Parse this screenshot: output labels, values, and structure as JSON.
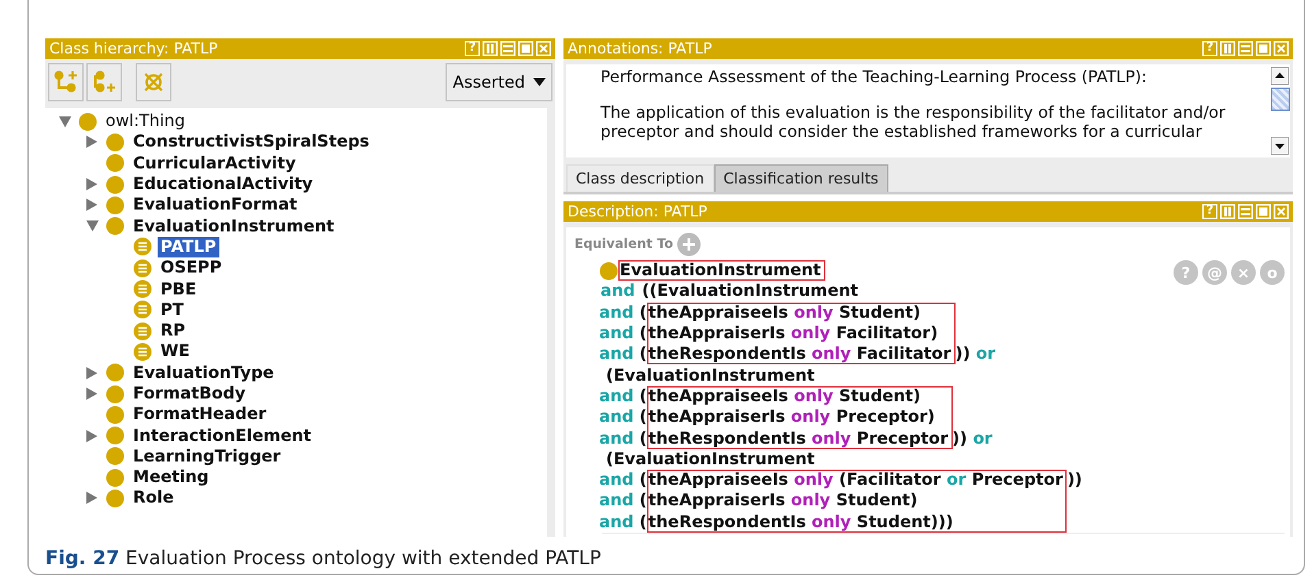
{
  "class_hierarchy": {
    "title": "Class hierarchy: PATLP",
    "help": "?",
    "view_mode": "Asserted",
    "tree": [
      {
        "label": "owl:Thing",
        "kind": "class",
        "expanded": true,
        "selected": false,
        "children": [
          {
            "label": "ConstructivistSpiralSteps",
            "kind": "class",
            "expanded": false,
            "selected": false
          },
          {
            "label": "CurricularActivity",
            "kind": "class",
            "selected": false
          },
          {
            "label": "EducationalActivity",
            "kind": "class",
            "expanded": false,
            "selected": false
          },
          {
            "label": "EvaluationFormat",
            "kind": "class",
            "expanded": false,
            "selected": false
          },
          {
            "label": "EvaluationInstrument",
            "kind": "class",
            "expanded": true,
            "selected": false,
            "children": [
              {
                "label": "PATLP",
                "kind": "defined",
                "selected": true
              },
              {
                "label": "OSEPP",
                "kind": "defined",
                "selected": false
              },
              {
                "label": "PBE",
                "kind": "defined",
                "selected": false
              },
              {
                "label": "PT",
                "kind": "defined",
                "selected": false
              },
              {
                "label": "RP",
                "kind": "defined",
                "selected": false
              },
              {
                "label": "WE",
                "kind": "defined",
                "selected": false
              }
            ]
          },
          {
            "label": "EvaluationType",
            "kind": "class",
            "expanded": false,
            "selected": false
          },
          {
            "label": "FormatBody",
            "kind": "class",
            "expanded": false,
            "selected": false
          },
          {
            "label": "FormatHeader",
            "kind": "class",
            "selected": false
          },
          {
            "label": "InteractionElement",
            "kind": "class",
            "expanded": false,
            "selected": false
          },
          {
            "label": "LearningTrigger",
            "kind": "class",
            "selected": false
          },
          {
            "label": "Meeting",
            "kind": "class",
            "selected": false
          },
          {
            "label": "Role",
            "kind": "class",
            "expanded": false,
            "selected": false
          }
        ]
      }
    ]
  },
  "annotations": {
    "title": "Annotations: PATLP",
    "help": "?",
    "paragraphs": [
      [
        "Performance Assessment of the Teaching-Learning Process (PATLP):"
      ],
      [
        "The application of this evaluation is the responsibility of the facilitator and/or",
        "preceptor and should consider the established frameworks for a curricular"
      ]
    ]
  },
  "tabs": [
    {
      "label": "Class description",
      "selected": true
    },
    {
      "label": "Classification results",
      "selected": false
    }
  ],
  "description": {
    "title": "Description: PATLP",
    "help": "?",
    "section": "Equivalent To",
    "frame_buttons": [
      "?",
      "@",
      "×",
      "o"
    ],
    "blocks": [
      {
        "highlighted": true,
        "lines": [
          {
            "kind": "class_head",
            "body": [
              {
                "text": "EvaluationInstrument",
                "kind": "plain"
              }
            ]
          }
        ]
      },
      {
        "highlighted": false,
        "lines": [
          {
            "lead": [
              {
                "text": "and",
                "kind": "keyword"
              }
            ],
            "body": [
              {
                "text": "((EvaluationInstrument",
                "kind": "plain"
              }
            ]
          }
        ]
      },
      {
        "highlighted": true,
        "lines": [
          {
            "lead": [
              {
                "text": "and",
                "kind": "keyword"
              },
              {
                "text": " (",
                "kind": "plain"
              }
            ],
            "body": [
              {
                "text": "theAppraiseeIs ",
                "kind": "plain"
              },
              {
                "text": "only",
                "kind": "restriction"
              },
              {
                "text": " Student)",
                "kind": "plain"
              }
            ]
          },
          {
            "lead": [
              {
                "text": "and",
                "kind": "keyword"
              },
              {
                "text": " (",
                "kind": "plain"
              }
            ],
            "body": [
              {
                "text": "theAppraiserIs ",
                "kind": "plain"
              },
              {
                "text": "only",
                "kind": "restriction"
              },
              {
                "text": " Facilitator)",
                "kind": "plain"
              }
            ]
          },
          {
            "lead": [
              {
                "text": "and",
                "kind": "keyword"
              },
              {
                "text": " (",
                "kind": "plain"
              }
            ],
            "body": [
              {
                "text": "theRespondentIs ",
                "kind": "plain"
              },
              {
                "text": "only",
                "kind": "restriction"
              },
              {
                "text": " Facilitator",
                "kind": "plain"
              }
            ],
            "tail": [
              {
                "text": ")) ",
                "kind": "plain"
              },
              {
                "text": "or",
                "kind": "keyword"
              }
            ]
          }
        ]
      },
      {
        "highlighted": false,
        "lines": [
          {
            "body": [
              {
                "text": "(EvaluationInstrument",
                "kind": "plain"
              }
            ]
          }
        ]
      },
      {
        "highlighted": true,
        "lines": [
          {
            "lead": [
              {
                "text": "and",
                "kind": "keyword"
              },
              {
                "text": " (",
                "kind": "plain"
              }
            ],
            "body": [
              {
                "text": "theAppraiseeIs ",
                "kind": "plain"
              },
              {
                "text": "only",
                "kind": "restriction"
              },
              {
                "text": " Student)",
                "kind": "plain"
              }
            ]
          },
          {
            "lead": [
              {
                "text": "and",
                "kind": "keyword"
              },
              {
                "text": " (",
                "kind": "plain"
              }
            ],
            "body": [
              {
                "text": "theAppraiserIs ",
                "kind": "plain"
              },
              {
                "text": "only",
                "kind": "restriction"
              },
              {
                "text": " Preceptor)",
                "kind": "plain"
              }
            ]
          },
          {
            "lead": [
              {
                "text": "and",
                "kind": "keyword"
              },
              {
                "text": " (",
                "kind": "plain"
              }
            ],
            "body": [
              {
                "text": "theRespondentIs ",
                "kind": "plain"
              },
              {
                "text": "only",
                "kind": "restriction"
              },
              {
                "text": " Preceptor",
                "kind": "plain"
              }
            ],
            "tail": [
              {
                "text": ")) ",
                "kind": "plain"
              },
              {
                "text": "or",
                "kind": "keyword"
              }
            ]
          }
        ]
      },
      {
        "highlighted": false,
        "lines": [
          {
            "body": [
              {
                "text": "(EvaluationInstrument",
                "kind": "plain"
              }
            ]
          }
        ]
      },
      {
        "highlighted": true,
        "lines": [
          {
            "lead": [
              {
                "text": "and",
                "kind": "keyword"
              },
              {
                "text": " (",
                "kind": "plain"
              }
            ],
            "body": [
              {
                "text": "theAppraiseeIs ",
                "kind": "plain"
              },
              {
                "text": "only",
                "kind": "restriction"
              },
              {
                "text": " (Facilitator ",
                "kind": "plain"
              },
              {
                "text": "or",
                "kind": "keyword"
              },
              {
                "text": " Preceptor",
                "kind": "plain"
              }
            ],
            "tail": [
              {
                "text": "))",
                "kind": "plain"
              }
            ]
          },
          {
            "lead": [
              {
                "text": "and",
                "kind": "keyword"
              },
              {
                "text": " (",
                "kind": "plain"
              }
            ],
            "body": [
              {
                "text": "theAppraiserIs ",
                "kind": "plain"
              },
              {
                "text": "only",
                "kind": "restriction"
              },
              {
                "text": " Student)",
                "kind": "plain"
              }
            ]
          },
          {
            "lead": [
              {
                "text": "and",
                "kind": "keyword"
              },
              {
                "text": " (",
                "kind": "plain"
              }
            ],
            "body": [
              {
                "text": "theRespondentIs ",
                "kind": "plain"
              },
              {
                "text": "only",
                "kind": "restriction"
              },
              {
                "text": " Student)))",
                "kind": "plain"
              }
            ]
          }
        ]
      }
    ]
  },
  "caption": "**Fig. 27** Evaluation Process ontology with extended PATLP"
}
